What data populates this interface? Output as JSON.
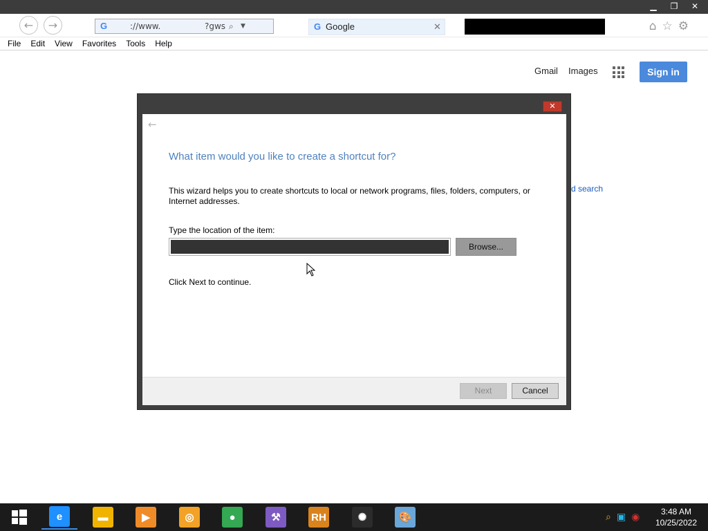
{
  "browser": {
    "address_text": "://www.",
    "address_suffix": "?gws",
    "tab_title": "Google",
    "menu": [
      "File",
      "Edit",
      "View",
      "Favorites",
      "Tools",
      "Help"
    ],
    "window_buttons": {
      "minimize": "▁",
      "restore": "❐",
      "close": "✕"
    }
  },
  "google": {
    "links": {
      "gmail": "Gmail",
      "images": "Images"
    },
    "signin_label": "Sign in",
    "partial_search_text": "d search"
  },
  "wizard": {
    "close_label": "✕",
    "heading": "What item would you like to create a shortcut for?",
    "description": "This wizard helps you to create shortcuts to local or network programs, files, folders, computers, or Internet addresses.",
    "location_label": "Type the location of the item:",
    "location_value": "",
    "browse_label": "Browse...",
    "hint": "Click Next to continue.",
    "next_label": "Next",
    "cancel_label": "Cancel"
  },
  "taskbar": {
    "items": [
      {
        "name": "internet-explorer-icon",
        "glyph": "e",
        "color": "#1e90ff"
      },
      {
        "name": "file-explorer-icon",
        "glyph": "▬",
        "color": "#f0b400"
      },
      {
        "name": "media-player-icon",
        "glyph": "▶",
        "color": "#f08c28"
      },
      {
        "name": "uc-browser-icon",
        "glyph": "◎",
        "color": "#f2a227"
      },
      {
        "name": "chrome-icon",
        "glyph": "●",
        "color": "#34a853"
      },
      {
        "name": "visual-studio-icon",
        "glyph": "⚒",
        "color": "#7d5bc2"
      },
      {
        "name": "rh-app-icon",
        "glyph": "RH",
        "color": "#d9831f"
      },
      {
        "name": "color-wheel-icon",
        "glyph": "✺",
        "color": "#2b2b2b"
      },
      {
        "name": "paint-palette-icon",
        "glyph": "🎨",
        "color": "#6aa6d8"
      }
    ],
    "time": "3:48 AM",
    "date": "10/25/2022"
  }
}
